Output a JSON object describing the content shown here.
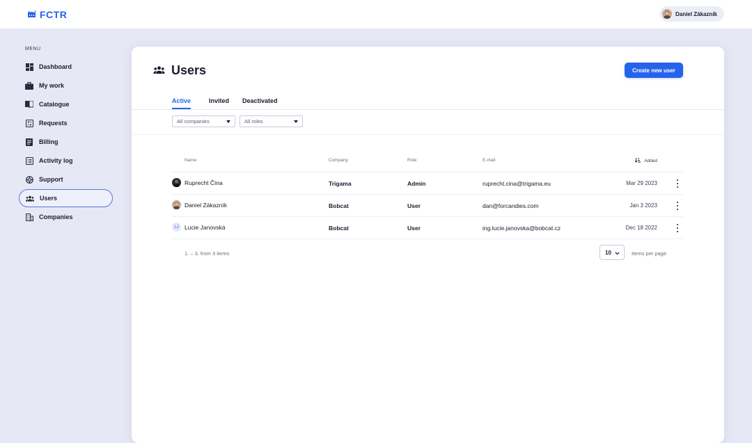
{
  "app": {
    "logo_text": "FCTR",
    "brand_color": "#2563eb"
  },
  "user": {
    "name": "Daniel Zákazník"
  },
  "sidebar": {
    "caption": "MENU",
    "items": [
      {
        "label": "Dashboard",
        "icon": "dashboard-icon"
      },
      {
        "label": "My work",
        "icon": "briefcase-icon"
      },
      {
        "label": "Catalogue",
        "icon": "book-icon"
      },
      {
        "label": "Requests",
        "icon": "requests-icon"
      },
      {
        "label": "Billing",
        "icon": "receipt-icon"
      },
      {
        "label": "Activity log",
        "icon": "list-icon"
      },
      {
        "label": "Support",
        "icon": "lifebuoy-icon"
      },
      {
        "label": "Users",
        "icon": "users-icon",
        "active": true
      },
      {
        "label": "Companies",
        "icon": "building-icon"
      }
    ]
  },
  "page": {
    "title": "Users",
    "create_button": "Create new user",
    "tabs": [
      "Active",
      "Invited",
      "Deactivated"
    ],
    "active_tab": "Active",
    "filters": {
      "company": "All companies",
      "role": "All roles"
    }
  },
  "table": {
    "columns": {
      "name": "Name",
      "company": "Company",
      "role": "Role",
      "email": "E-mail",
      "added": "Added"
    },
    "rows": [
      {
        "name": "Ruprecht Čína",
        "company": "Trigama",
        "role": "Admin",
        "email": "ruprecht.cina@trigama.eu",
        "added": "Mar 29 2023",
        "avatar": "photo-dark"
      },
      {
        "name": "Daniel Zákazník",
        "company": "Bobcat",
        "role": "User",
        "email": "dan@forcandies.com",
        "added": "Jan 3 2023",
        "avatar": "photo"
      },
      {
        "name": "Lucie Janovská",
        "company": "Bobcat",
        "role": "User",
        "email": "ing.lucie.janovska@bobcat.cz",
        "added": "Dec 18 2022",
        "avatar": "initials",
        "initials": "LJ"
      }
    ]
  },
  "pagination": {
    "info": "1. – 3. from 3 items",
    "per_page": "10",
    "per_page_label": "Items per page"
  }
}
